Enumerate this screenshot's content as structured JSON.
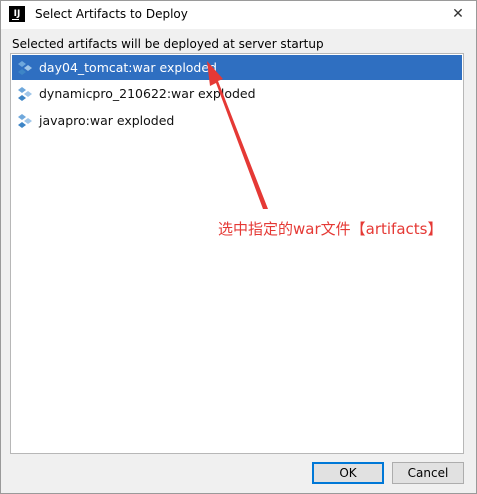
{
  "window": {
    "app_icon_text": "IJ",
    "title": "Select Artifacts to Deploy",
    "close_glyph": "✕"
  },
  "heading": "Selected artifacts will be deployed at server startup",
  "artifacts": [
    {
      "label": "day04_tomcat:war exploded",
      "selected": true,
      "icon": "artifact-icon"
    },
    {
      "label": "dynamicpro_210622:war exploded",
      "selected": false,
      "icon": "artifact-icon"
    },
    {
      "label": "javapro:war exploded",
      "selected": false,
      "icon": "artifact-icon"
    }
  ],
  "annotation": {
    "text": "选中指定的war文件【artifacts】",
    "color": "#e53935"
  },
  "buttons": {
    "ok": "OK",
    "cancel": "Cancel"
  },
  "colors": {
    "selection": "#2f6fc1",
    "accent_border": "#0078d7"
  }
}
